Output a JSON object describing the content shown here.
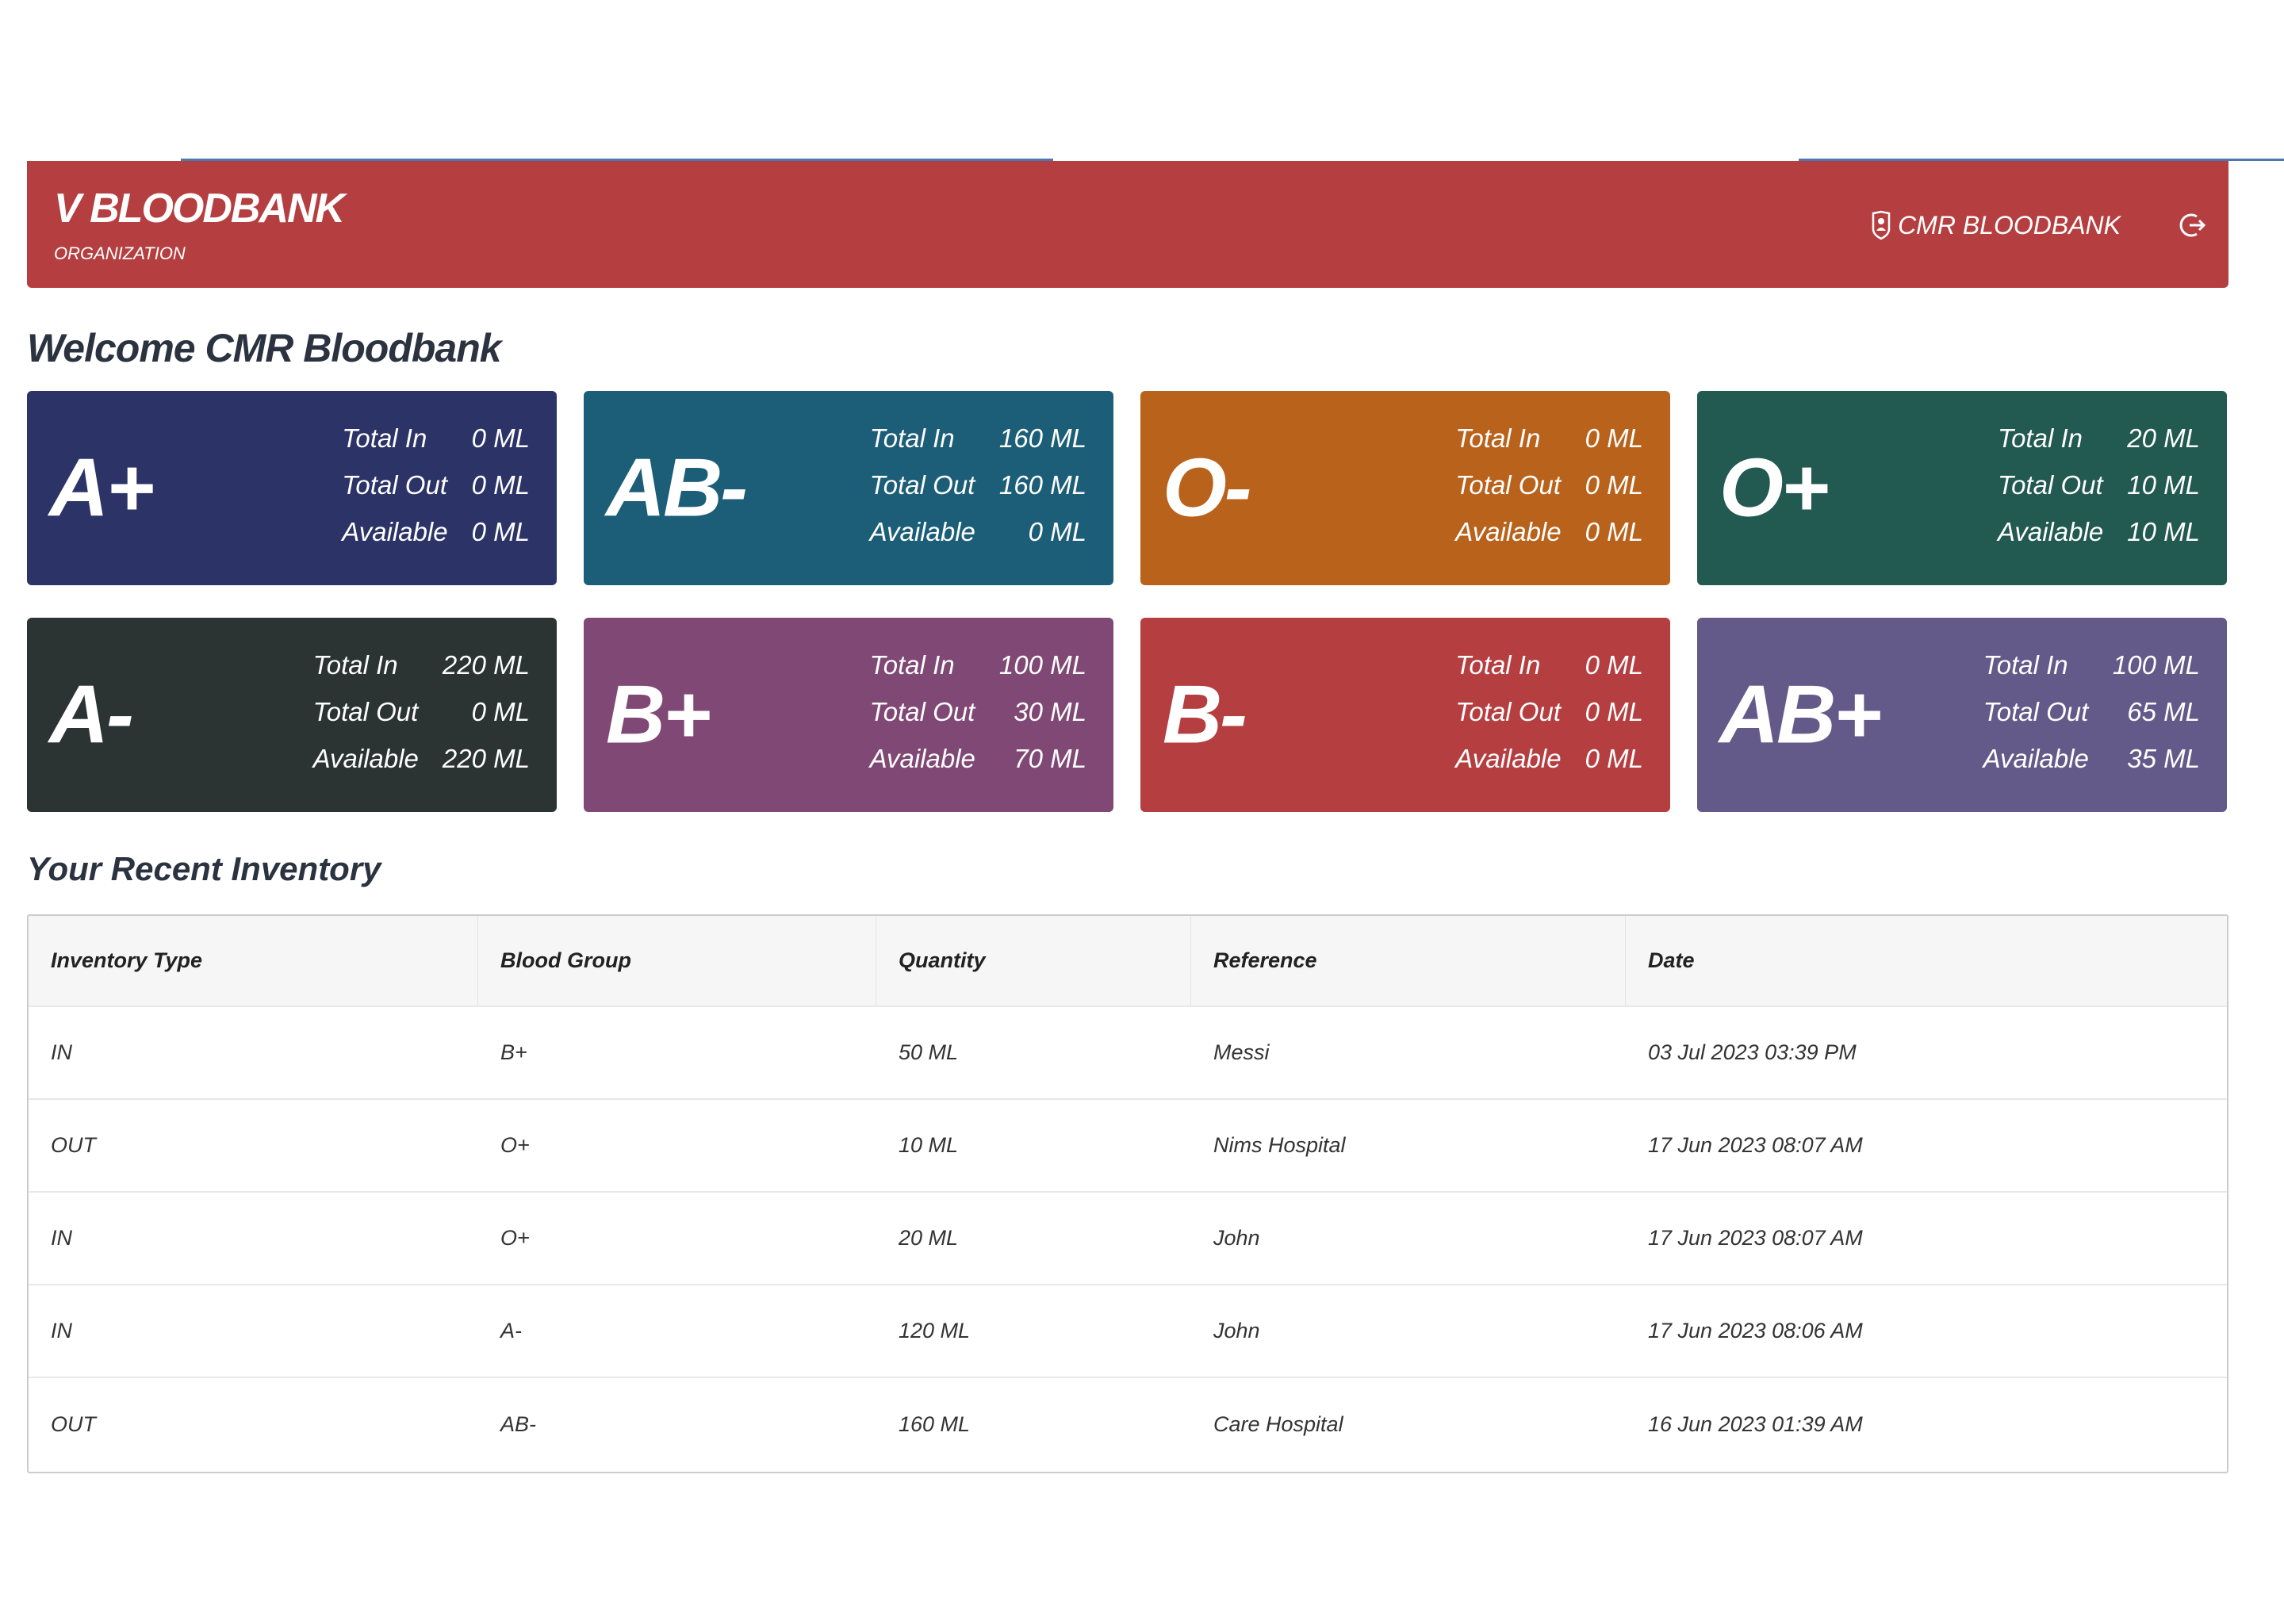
{
  "header": {
    "brand": "V BLOODBANK",
    "role": "ORGANIZATION",
    "user": "CMR BLOODBANK"
  },
  "welcome": "Welcome CMR Bloodbank",
  "labels": {
    "in": "Total In",
    "out": "Total Out",
    "avail": "Available"
  },
  "cards": [
    {
      "group": "A+",
      "in": "0 ML",
      "out": "0 ML",
      "avail": "0 ML",
      "color": "#2c3366"
    },
    {
      "group": "AB-",
      "in": "160 ML",
      "out": "160 ML",
      "avail": "0 ML",
      "color": "#1c5e77"
    },
    {
      "group": "O-",
      "in": "0 ML",
      "out": "0 ML",
      "avail": "0 ML",
      "color": "#b9621c"
    },
    {
      "group": "O+",
      "in": "20 ML",
      "out": "10 ML",
      "avail": "10 ML",
      "color": "#225951"
    },
    {
      "group": "A-",
      "in": "220 ML",
      "out": "0 ML",
      "avail": "220 ML",
      "color": "#2c3333"
    },
    {
      "group": "B+",
      "in": "100 ML",
      "out": "30 ML",
      "avail": "70 ML",
      "color": "#804874"
    },
    {
      "group": "B-",
      "in": "0 ML",
      "out": "0 ML",
      "avail": "0 ML",
      "color": "#b53e40"
    },
    {
      "group": "AB+",
      "in": "100 ML",
      "out": "65 ML",
      "avail": "35 ML",
      "color": "#645a89"
    }
  ],
  "inventory": {
    "title": "Your Recent Inventory",
    "columns": [
      "Inventory Type",
      "Blood Group",
      "Quantity",
      "Reference",
      "Date"
    ],
    "rows": [
      [
        "IN",
        "B+",
        "50 ML",
        "Messi",
        "03 Jul 2023 03:39 PM"
      ],
      [
        "OUT",
        "O+",
        "10 ML",
        "Nims Hospital",
        "17 Jun 2023 08:07 AM"
      ],
      [
        "IN",
        "O+",
        "20 ML",
        "John",
        "17 Jun 2023 08:07 AM"
      ],
      [
        "IN",
        "A-",
        "120 ML",
        "John",
        "17 Jun 2023 08:06 AM"
      ],
      [
        "OUT",
        "AB-",
        "160 ML",
        "Care Hospital",
        "16 Jun 2023 01:39 AM"
      ]
    ]
  }
}
